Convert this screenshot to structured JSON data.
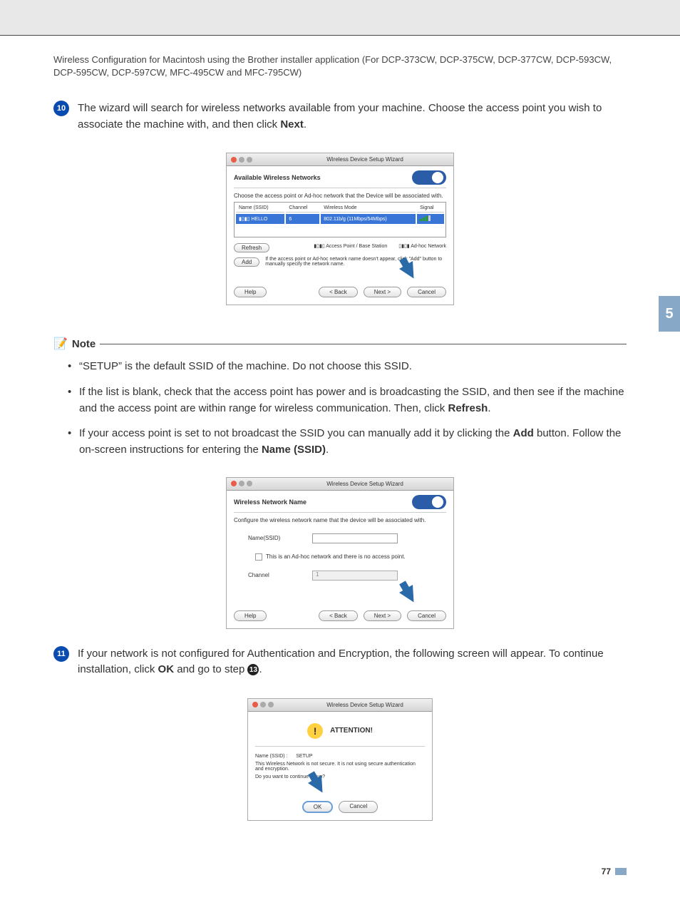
{
  "header": "Wireless Configuration for Macintosh using the Brother installer application (For DCP-373CW, DCP-375CW, DCP-377CW, DCP-593CW, DCP-595CW, DCP-597CW, MFC-495CW and MFC-795CW)",
  "chapter_tab": "5",
  "page_number": "77",
  "step10": {
    "num": "10",
    "text_a": "The wizard will search for wireless networks available from your machine. Choose the access point you wish to associate the machine with, and then click ",
    "bold": "Next",
    "text_b": "."
  },
  "shot1": {
    "title": "Wireless Device Setup Wizard",
    "heading": "Available Wireless Networks",
    "desc": "Choose the access point or Ad-hoc network that the Device will be associated with.",
    "cols": {
      "name": "Name (SSID)",
      "channel": "Channel",
      "mode": "Wireless Mode",
      "signal": "Signal"
    },
    "row": {
      "name": "HELLO",
      "channel": "6",
      "mode": "802.11b/g (11Mbps/54Mbps)"
    },
    "refresh": "Refresh",
    "legend_ap": "Access Point / Base Station",
    "legend_adhoc": "Ad-hoc Network",
    "add": "Add",
    "add_desc": "If the access point or Ad-hoc network name doesn't appear, click \"Add\" button to manually specify the network name.",
    "help": "Help",
    "back": "< Back",
    "next": "Next >",
    "cancel": "Cancel"
  },
  "note": {
    "label": "Note",
    "li1_a": "“SETUP” is the default SSID of the machine. Do not choose this SSID.",
    "li2_a": "If the list is blank, check that the access point has power and is broadcasting the SSID, and then see if the machine and the access point are within range for wireless communication. Then, click ",
    "li2_b": "Refresh",
    "li2_c": ".",
    "li3_a": "If your access point is set to not broadcast the SSID you can manually add it by clicking the ",
    "li3_b": "Add",
    "li3_c": " button. Follow the on-screen instructions for entering the ",
    "li3_d": "Name (SSID)",
    "li3_e": "."
  },
  "shot2": {
    "title": "Wireless Device Setup Wizard",
    "heading": "Wireless Network Name",
    "desc": "Configure the wireless network name that the device will be associated with.",
    "name_lbl": "Name(SSID)",
    "cb": "This is an Ad-hoc network and there is no access point.",
    "channel_lbl": "Channel",
    "channel_val": "1",
    "help": "Help",
    "back": "< Back",
    "next": "Next >",
    "cancel": "Cancel"
  },
  "step11": {
    "num": "11",
    "text_a": "If your network is not configured for Authentication and Encryption, the following screen will appear. To continue installation, click ",
    "bold": "OK",
    "text_b": " and go to step ",
    "ref": "13",
    "text_c": "."
  },
  "shot3": {
    "title": "Wireless Device Setup Wizard",
    "attention": "ATTENTION!",
    "ssid_lbl": "Name (SSID) :",
    "ssid_val": "SETUP",
    "warn": "This Wireless Network is not secure. It is not using secure authentication and encryption.",
    "q": "Do you want to continue setup?",
    "ok": "OK",
    "cancel": "Cancel"
  }
}
